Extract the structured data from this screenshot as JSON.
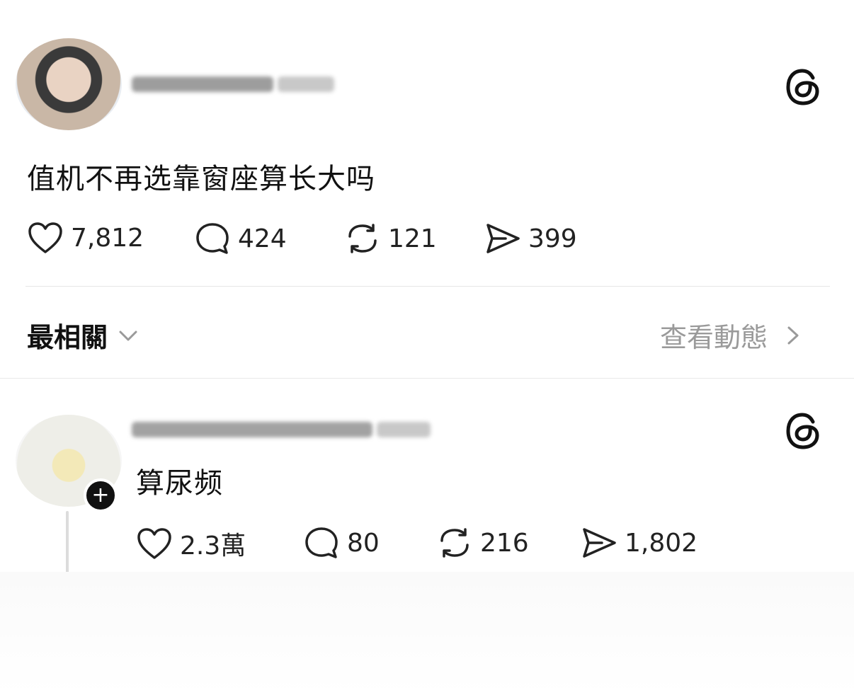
{
  "post": {
    "username": "",
    "time": "",
    "text": "值机不再选靠窗座算长大吗",
    "stats": {
      "likes": "7,812",
      "comments": "424",
      "reposts": "121",
      "shares": "399"
    }
  },
  "filter_bar": {
    "sort_label": "最相關",
    "view_activity_label": "查看動態"
  },
  "reply": {
    "username": "",
    "time": "",
    "text": "算尿频",
    "stats": {
      "likes": "2.3萬",
      "comments": "80",
      "reposts": "216",
      "shares": "1,802"
    }
  },
  "colors": {
    "text_primary": "#111111",
    "text_secondary": "#9a9a9a",
    "divider": "#e6e6e6",
    "background": "#ffffff"
  },
  "icons": [
    "threads-logo-icon",
    "heart-icon",
    "comment-icon",
    "repost-icon",
    "send-icon",
    "chevron-down-icon",
    "chevron-right-icon",
    "plus-icon"
  ]
}
